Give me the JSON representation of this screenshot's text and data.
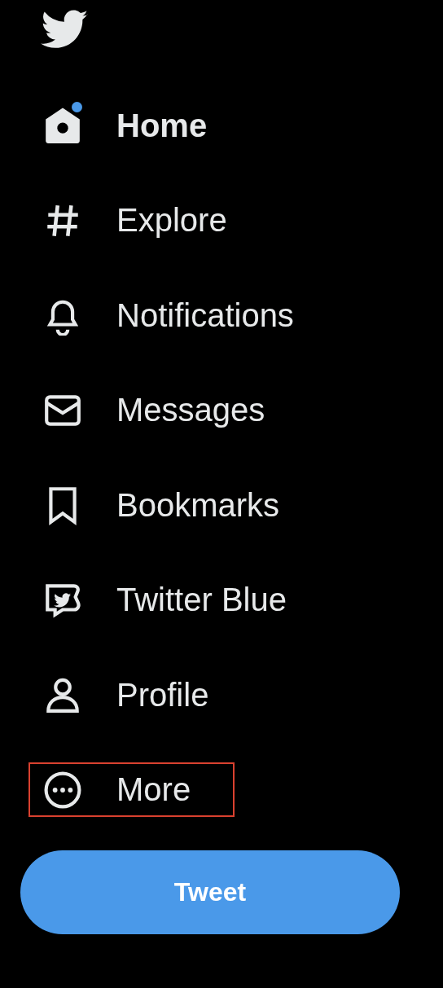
{
  "nav": {
    "items": [
      {
        "kind": "home",
        "label": "Home",
        "selected": true,
        "notification_dot": true,
        "highlighted": false
      },
      {
        "kind": "explore",
        "label": "Explore",
        "selected": false,
        "notification_dot": false,
        "highlighted": false
      },
      {
        "kind": "notifications",
        "label": "Notifications",
        "selected": false,
        "notification_dot": false,
        "highlighted": false
      },
      {
        "kind": "messages",
        "label": "Messages",
        "selected": false,
        "notification_dot": false,
        "highlighted": false
      },
      {
        "kind": "bookmarks",
        "label": "Bookmarks",
        "selected": false,
        "notification_dot": false,
        "highlighted": false
      },
      {
        "kind": "twitter_blue",
        "label": "Twitter Blue",
        "selected": false,
        "notification_dot": false,
        "highlighted": false
      },
      {
        "kind": "profile",
        "label": "Profile",
        "selected": false,
        "notification_dot": false,
        "highlighted": false
      },
      {
        "kind": "more",
        "label": "More",
        "selected": false,
        "notification_dot": false,
        "highlighted": true
      }
    ]
  },
  "tweet_button": {
    "label": "Tweet"
  }
}
